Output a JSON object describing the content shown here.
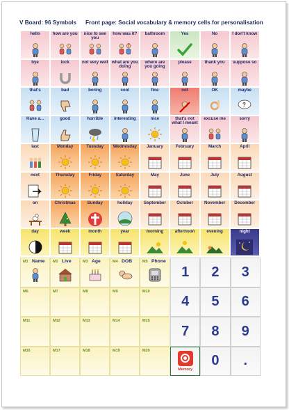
{
  "header": {
    "title": "V Board: 96 Symbols",
    "subtitle": "Front page: Social vocabulary & memory cells for personalisation"
  },
  "rows": [
    [
      {
        "label": "hello",
        "icon": "waving-person-icon",
        "color": "pink"
      },
      {
        "label": "how are you",
        "icon": "two-people-talking-icon",
        "color": "pink"
      },
      {
        "label": "nice to see you",
        "icon": "two-people-meeting-icon",
        "color": "pink"
      },
      {
        "label": "how was it?",
        "icon": "question-person-icon",
        "color": "pink"
      },
      {
        "label": "bathroom",
        "icon": "bathtub-icon",
        "color": "pink"
      },
      {
        "label": "Yes",
        "icon": "checkmark-icon",
        "color": "green"
      },
      {
        "label": "No",
        "icon": "no-sign-person-icon",
        "color": "pink"
      },
      {
        "label": "I don't know",
        "icon": "shrug-person-icon",
        "color": "pink"
      },
      {
        "label": "",
        "icon": "",
        "color": "none"
      },
      {
        "label": "",
        "icon": "",
        "color": "none"
      }
    ],
    [
      {
        "label": "bye",
        "icon": "waving-goodbye-icon",
        "color": "pink"
      },
      {
        "label": "luck",
        "icon": "horseshoe-icon",
        "color": "pink"
      },
      {
        "label": "not very well",
        "icon": "sick-person-icon",
        "color": "pink"
      },
      {
        "label": "what are you doing",
        "icon": "person-activity-icon",
        "color": "pink"
      },
      {
        "label": "where are you going",
        "icon": "walking-person-icon",
        "color": "pink"
      },
      {
        "label": "please",
        "icon": "please-hands-icon",
        "color": "pink"
      },
      {
        "label": "thank you",
        "icon": "thank-you-icon",
        "color": "pink"
      },
      {
        "label": "suppose so",
        "icon": "thinking-person-icon",
        "color": "pink"
      },
      {
        "label": "",
        "icon": "",
        "color": "none"
      },
      {
        "label": "",
        "icon": "",
        "color": "none"
      }
    ],
    [
      {
        "label": "that's",
        "icon": "pointing-people-icon",
        "color": "blue"
      },
      {
        "label": "bad",
        "icon": "thumbs-down-icon",
        "color": "blue"
      },
      {
        "label": "boring",
        "icon": "bored-person-icon",
        "color": "blue"
      },
      {
        "label": "cool",
        "icon": "cool-person-icon",
        "color": "blue"
      },
      {
        "label": "fine",
        "icon": "fine-person-icon",
        "color": "blue"
      },
      {
        "label": "not",
        "icon": "not-sign-icon",
        "color": "red"
      },
      {
        "label": "OK",
        "icon": "ok-hand-icon",
        "color": "blue"
      },
      {
        "label": "maybe",
        "icon": "maybe-cloud-icon",
        "color": "blue"
      },
      {
        "label": "",
        "icon": "",
        "color": "none"
      },
      {
        "label": "",
        "icon": "",
        "color": "none"
      }
    ],
    [
      {
        "label": "Have a...",
        "icon": "glass-icon",
        "color": "blue"
      },
      {
        "label": "good",
        "icon": "thumbs-up-icon",
        "color": "blue"
      },
      {
        "label": "horrible",
        "icon": "storm-cloud-icon",
        "color": "blue"
      },
      {
        "label": "interesting",
        "icon": "interested-person-icon",
        "color": "blue"
      },
      {
        "label": "nice",
        "icon": "sun-icon",
        "color": "blue"
      },
      {
        "label": "that's not what I meant",
        "icon": "confused-person-icon",
        "color": "pink"
      },
      {
        "label": "excuse me",
        "icon": "excuse-me-icon",
        "color": "pink"
      },
      {
        "label": "sorry",
        "icon": "sorry-person-icon",
        "color": "pink"
      },
      {
        "label": "",
        "icon": "",
        "color": "none"
      },
      {
        "label": "",
        "icon": "",
        "color": "none"
      }
    ],
    [
      {
        "label": "last",
        "icon": "person-line-icon",
        "color": "peach"
      },
      {
        "label": "Monday",
        "icon": "sun-day-icon",
        "color": "orange"
      },
      {
        "label": "Tuesday",
        "icon": "sun-day-icon",
        "color": "orange"
      },
      {
        "label": "Wednesday",
        "icon": "sun-day-icon",
        "color": "orange"
      },
      {
        "label": "January",
        "icon": "calendar-icon",
        "color": "peach"
      },
      {
        "label": "February",
        "icon": "calendar-icon",
        "color": "peach"
      },
      {
        "label": "March",
        "icon": "calendar-icon",
        "color": "peach"
      },
      {
        "label": "April",
        "icon": "calendar-icon",
        "color": "peach"
      },
      {
        "label": "",
        "icon": "",
        "color": "none"
      },
      {
        "label": "",
        "icon": "",
        "color": "none"
      }
    ],
    [
      {
        "label": "next",
        "icon": "next-arrow-icon",
        "color": "peach"
      },
      {
        "label": "Thursday",
        "icon": "sun-day-icon",
        "color": "orange"
      },
      {
        "label": "Friday",
        "icon": "sun-day-icon",
        "color": "orange"
      },
      {
        "label": "Saturday",
        "icon": "sun-day-icon",
        "color": "orange"
      },
      {
        "label": "May",
        "icon": "calendar-icon",
        "color": "peach"
      },
      {
        "label": "June",
        "icon": "calendar-icon",
        "color": "peach"
      },
      {
        "label": "July",
        "icon": "calendar-icon",
        "color": "peach"
      },
      {
        "label": "August",
        "icon": "calendar-icon",
        "color": "peach"
      },
      {
        "label": "",
        "icon": "",
        "color": "none"
      },
      {
        "label": "",
        "icon": "",
        "color": "none"
      }
    ]
  ],
  "row7": [
    {
      "label": "on",
      "icon": "cat-on-table-icon",
      "color": "peach"
    },
    {
      "label": "Christmas",
      "icon": "christmas-tree-icon",
      "color": "orange"
    },
    {
      "label": "Sunday",
      "icon": "church-icon",
      "color": "orange"
    },
    {
      "label": "holiday",
      "icon": "holiday-icon",
      "color": "peach"
    },
    {
      "label": "September",
      "icon": "calendar-icon",
      "color": "peach"
    },
    {
      "label": "October",
      "icon": "calendar-icon",
      "color": "peach"
    },
    {
      "label": "November",
      "icon": "calendar-icon",
      "color": "peach"
    },
    {
      "label": "December",
      "icon": "calendar-icon",
      "color": "peach"
    }
  ],
  "row8": [
    {
      "label": "day",
      "icon": "day-night-icon",
      "color": "yellow"
    },
    {
      "label": "week",
      "icon": "week-calendar-icon",
      "color": "yellow"
    },
    {
      "label": "month",
      "icon": "month-calendar-icon",
      "color": "yellow"
    },
    {
      "label": "year",
      "icon": "year-calendar-icon",
      "color": "yellow"
    },
    {
      "label": "morning",
      "icon": "morning-icon",
      "color": "yellow"
    },
    {
      "label": "afternoon",
      "icon": "afternoon-icon",
      "color": "yellow"
    },
    {
      "label": "evening",
      "icon": "evening-icon",
      "color": "yellow"
    },
    {
      "label": "night",
      "icon": "night-icon",
      "color": "purple"
    }
  ],
  "memory_cells": [
    {
      "num": "M1",
      "name": "Name",
      "icon": "person-icon"
    },
    {
      "num": "M2",
      "name": "Live",
      "icon": "house-icon"
    },
    {
      "num": "M3",
      "name": "Age",
      "icon": "birthday-cake-icon"
    },
    {
      "num": "M4",
      "name": "DOB",
      "icon": "baby-icon"
    },
    {
      "num": "M5",
      "name": "Phone",
      "icon": "phone-icon"
    },
    {
      "num": "M6",
      "name": "",
      "icon": ""
    },
    {
      "num": "M7",
      "name": "",
      "icon": ""
    },
    {
      "num": "M8",
      "name": "",
      "icon": ""
    },
    {
      "num": "M9",
      "name": "",
      "icon": ""
    },
    {
      "num": "M10",
      "name": "",
      "icon": ""
    },
    {
      "num": "M11",
      "name": "",
      "icon": ""
    },
    {
      "num": "M12",
      "name": "",
      "icon": ""
    },
    {
      "num": "M13",
      "name": "",
      "icon": ""
    },
    {
      "num": "M14",
      "name": "",
      "icon": ""
    },
    {
      "num": "M15",
      "name": "",
      "icon": ""
    },
    {
      "num": "M16",
      "name": "",
      "icon": ""
    },
    {
      "num": "M17",
      "name": "",
      "icon": ""
    },
    {
      "num": "M18",
      "name": "",
      "icon": ""
    },
    {
      "num": "M19",
      "name": "",
      "icon": ""
    },
    {
      "num": "M20",
      "name": "",
      "icon": ""
    }
  ],
  "numpad": [
    "1",
    "2",
    "3",
    "4",
    "5",
    "6",
    "7",
    "8",
    "9",
    "MEMORY",
    "0",
    "."
  ],
  "memory_label": "Memory",
  "colors": {
    "label_text": "#1e2a6e",
    "memory_number": "#6b8e23",
    "digits": "#2c3b8d",
    "memory_button": "#e23b2e"
  }
}
